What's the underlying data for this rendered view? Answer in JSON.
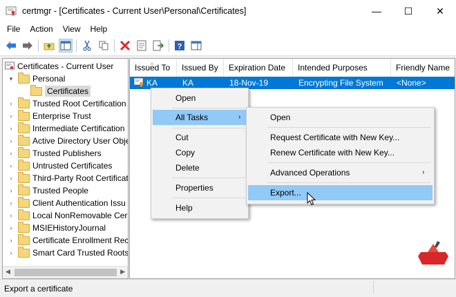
{
  "window": {
    "title": "certmgr - [Certificates - Current User\\Personal\\Certificates]",
    "minimize_glyph": "—",
    "maximize_glyph": "☐",
    "close_glyph": "✕"
  },
  "menubar": [
    "File",
    "Action",
    "View",
    "Help"
  ],
  "toolbar": {
    "icons": [
      "back-arrow-icon",
      "forward-arrow-icon",
      "up-folder-icon",
      "show-hide-console-tree-icon",
      "cut-icon",
      "copy-icon",
      "delete-icon",
      "properties-icon",
      "export-list-icon",
      "help-icon",
      "action-pane-icon"
    ]
  },
  "tree": {
    "root": "Certificates - Current User",
    "personal": "Personal",
    "certificates": "Certificates",
    "items": [
      "Trusted Root Certification",
      "Enterprise Trust",
      "Intermediate Certification",
      "Active Directory User Obje",
      "Trusted Publishers",
      "Untrusted Certificates",
      "Third-Party Root Certificat",
      "Trusted People",
      "Client Authentication Issu",
      "Local NonRemovable Cer",
      "MSIEHistoryJournal",
      "Certificate Enrollment Rec",
      "Smart Card Trusted Roots"
    ]
  },
  "list": {
    "columns": [
      "Issued To",
      "Issued By",
      "Expiration Date",
      "Intended Purposes",
      "Friendly Name"
    ],
    "rows": [
      {
        "issued_to": "KA",
        "issued_by": "KA",
        "expiration": "18-Nov-19",
        "purposes": "Encrypting File System",
        "friendly": "<None>"
      }
    ]
  },
  "context_menu": {
    "items": [
      "Open",
      "All Tasks",
      "Cut",
      "Copy",
      "Delete",
      "Properties",
      "Help"
    ],
    "highlighted": "All Tasks"
  },
  "submenu": {
    "items": [
      "Open",
      "Request Certificate with New Key...",
      "Renew Certificate with New Key...",
      "Advanced Operations",
      "Export..."
    ],
    "highlighted": "Export..."
  },
  "status": "Export a certificate",
  "colors": {
    "selection": "#0078d7",
    "menu_highlight": "#91c9f7",
    "folder": "#f4d67b"
  }
}
